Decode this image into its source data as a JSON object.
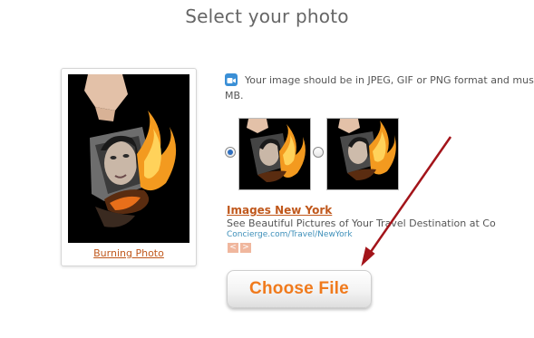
{
  "page": {
    "title": "Select your photo"
  },
  "preview": {
    "caption": "Burning Photo"
  },
  "format_note": {
    "line1": "Your image should be in JPEG, GIF or PNG format and must",
    "line2": "MB.",
    "icon": "video-icon"
  },
  "effect_options": [
    {
      "selected": true
    },
    {
      "selected": false
    }
  ],
  "ad": {
    "title": "Images New York",
    "description": "See Beautiful Pictures of Your Travel Destination at Co",
    "url": "Concierge.com/Travel/NewYork",
    "prev_label": "<",
    "next_label": ">"
  },
  "upload": {
    "button_label": "Choose File"
  },
  "colors": {
    "accent_orange": "#f07a1c",
    "link_orange": "#c0581c",
    "arrow_red": "#a3141a",
    "url_blue": "#3d8fb9"
  }
}
